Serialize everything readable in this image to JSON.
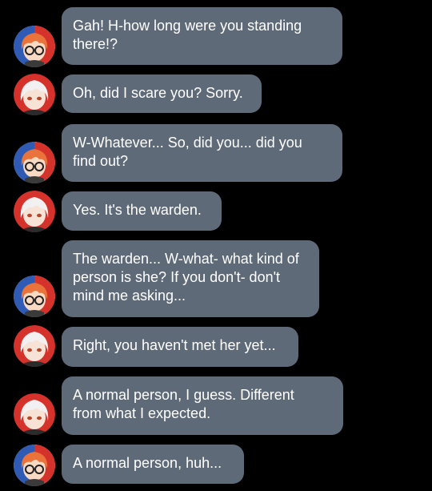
{
  "conversation": {
    "messages": [
      {
        "speaker": "orange-hair-glasses",
        "lines": [
          "Gah! H-how long were you standing",
          "there!?"
        ]
      },
      {
        "speaker": "white-hair",
        "lines": [
          "Oh, did I scare you? Sorry."
        ]
      },
      {
        "speaker": "orange-hair-glasses",
        "lines": [
          "W-Whatever... So, did you... did you",
          "find out?"
        ]
      },
      {
        "speaker": "white-hair",
        "lines": [
          "Yes. It's the warden."
        ]
      },
      {
        "speaker": "orange-hair-glasses",
        "lines": [
          "The warden... W-what- what kind of",
          "person is she? If you don't- don't",
          "mind me asking..."
        ]
      },
      {
        "speaker": "white-hair",
        "lines": [
          "Right, you haven't met her yet..."
        ]
      },
      {
        "speaker": "white-hair",
        "lines": [
          "A normal person, I guess. Different",
          "from what I expected."
        ]
      },
      {
        "speaker": "orange-hair-glasses",
        "lines": [
          "A normal person, huh..."
        ]
      }
    ]
  },
  "colors": {
    "background": "#000000",
    "bubble": "#5f6a78",
    "text": "#ffffff",
    "avatar_blue": "#2f5bb5",
    "avatar_red": "#d5322b",
    "orange_hair": "#e9733a",
    "white_hair": "#f2f0f0"
  }
}
